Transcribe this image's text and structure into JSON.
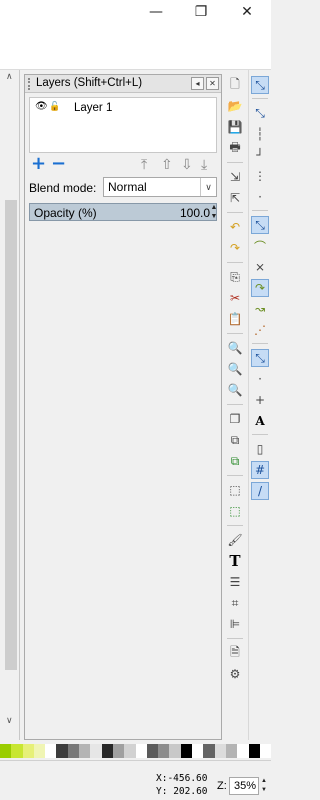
{
  "window": {
    "minimize_glyph": "—",
    "maximize_glyph": "❐",
    "close_glyph": "✕"
  },
  "layers_panel": {
    "title": "Layers (Shift+Ctrl+L)",
    "layers": [
      {
        "name": "Layer 1",
        "visible": true,
        "locked": false
      }
    ],
    "add_glyph": "+",
    "remove_glyph": "−",
    "blend_label": "Blend mode:",
    "blend_value": "Normal",
    "opacity_label": "Opacity (%)",
    "opacity_value": "100.0"
  },
  "status": {
    "x_label": "X:",
    "x_value": "-456.60",
    "y_label": "Y:",
    "y_value": "202.60",
    "zoom_label": "Z:",
    "zoom_value": "35%"
  },
  "palette_colors": [
    "#9acd00",
    "#c8e632",
    "#e6f078",
    "#f0f5b4",
    "#ffffff",
    "#3c3c3c",
    "#787878",
    "#b4b4b4",
    "#e6e6e6",
    "#282828",
    "#a0a0a0",
    "#d2d2d2",
    "#ffffff",
    "#5a5a5a",
    "#8c8c8c",
    "#c8c8c8",
    "#000000",
    "#ffffff",
    "#646464",
    "#dcdcdc",
    "#b4b4b4",
    "#ffffff",
    "#000000",
    "#ffffff"
  ],
  "colors": {
    "accent_selected": "#c6dcf5",
    "opacity_bar": "#bccad6",
    "plus_blue": "#1a6fd1"
  }
}
